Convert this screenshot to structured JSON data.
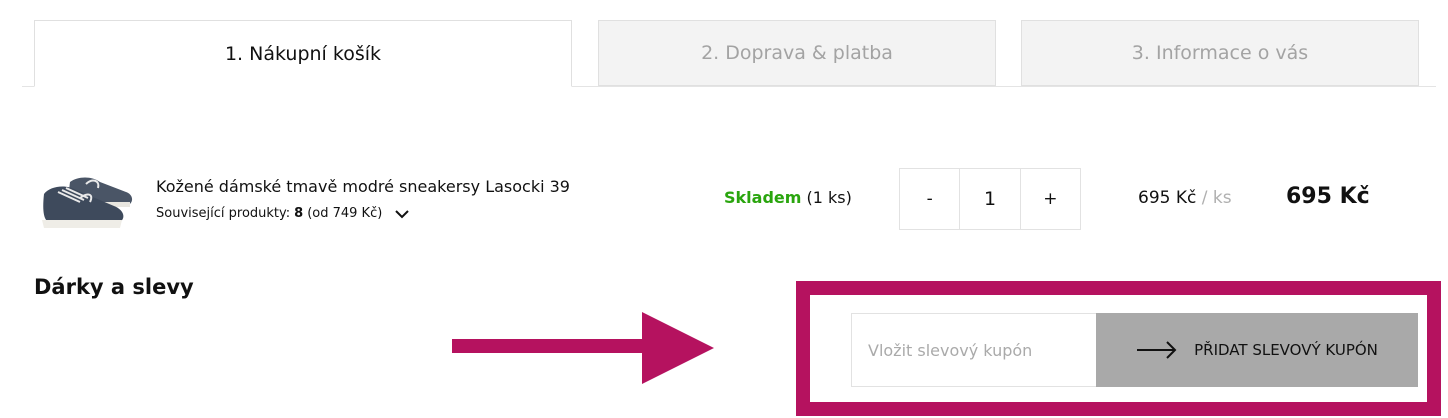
{
  "tabs": [
    {
      "label": "1. Nákupní košík",
      "active": true
    },
    {
      "label": "2. Doprava & platba",
      "active": false
    },
    {
      "label": "3. Informace o vás",
      "active": false
    }
  ],
  "cart": {
    "item": {
      "image_icon": "sneaker-product-image",
      "name": "Kožené dámské tmavě modré sneakersy Lasocki 39",
      "related_label": "Související produkty:",
      "related_count": "8",
      "related_price": "(od 749 Kč)",
      "stock_status": "Skladem",
      "stock_qty": "(1 ks)",
      "quantity": "1",
      "minus_label": "-",
      "plus_label": "+",
      "unit_price": "695 Kč",
      "unit_separator": "/",
      "unit_label": "ks",
      "total_price": "695 Kč"
    }
  },
  "gifts": {
    "title": "Dárky a slevy",
    "coupon_placeholder": "Vložit slevový kupón",
    "coupon_button_label": "PŘIDAT SLEVOVÝ KUPÓN"
  },
  "colors": {
    "highlight": "#b5125f",
    "stock_green": "#2aa50e",
    "button_gray": "#a9a9a9"
  }
}
